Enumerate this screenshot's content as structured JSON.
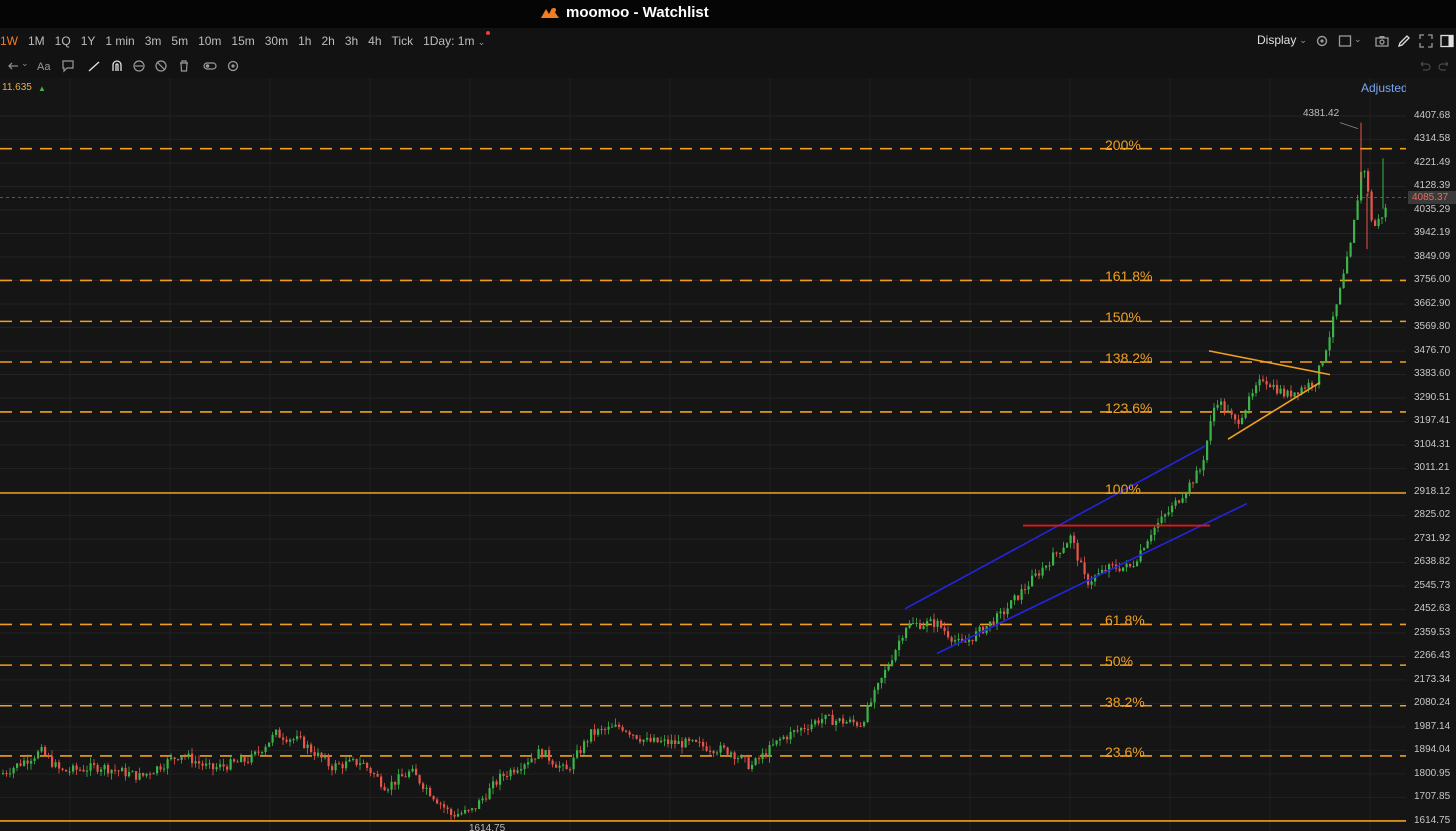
{
  "window": {
    "title": "moomoo - Watchlist"
  },
  "timeframes": [
    {
      "label": "1W",
      "active": true
    },
    {
      "label": "1M"
    },
    {
      "label": "1Q"
    },
    {
      "label": "1Y"
    },
    {
      "label": "1 min"
    },
    {
      "label": "3m"
    },
    {
      "label": "5m"
    },
    {
      "label": "10m"
    },
    {
      "label": "15m"
    },
    {
      "label": "30m"
    },
    {
      "label": "1h"
    },
    {
      "label": "2h"
    },
    {
      "label": "3h"
    },
    {
      "label": "4h"
    },
    {
      "label": "Tick"
    },
    {
      "label": "1Day: 1m"
    }
  ],
  "display_label": "Display",
  "indicator_value": "11.635",
  "adjusted_label": "Adjusted",
  "price_axis": [
    "4407.68",
    "4314.58",
    "4221.49",
    "4128.39",
    "4035.29",
    "3942.19",
    "3849.09",
    "3756.00",
    "3662.90",
    "3569.80",
    "3476.70",
    "3383.60",
    "3290.51",
    "3197.41",
    "3104.31",
    "3011.21",
    "2918.12",
    "2825.02",
    "2731.92",
    "2638.82",
    "2545.73",
    "2452.63",
    "2359.53",
    "2266.43",
    "2173.34",
    "2080.24",
    "1987.14",
    "1894.04",
    "1800.95",
    "1707.85"
  ],
  "current_price": "4085.37",
  "low_axis_price": "1614.75",
  "high_marker": "4381.42",
  "low_marker": "1614.75",
  "fib_levels": [
    {
      "label": "200%",
      "price": 4278
    },
    {
      "label": "161.8%",
      "price": 3756
    },
    {
      "label": "150%",
      "price": 3594
    },
    {
      "label": "138.2%",
      "price": 3433
    },
    {
      "label": "123.6%",
      "price": 3235
    },
    {
      "label": "100%",
      "price": 2914,
      "solid": true
    },
    {
      "label": "61.8%",
      "price": 2393
    },
    {
      "label": "50%",
      "price": 2232
    },
    {
      "label": "38.2%",
      "price": 2071
    },
    {
      "label": "23.6%",
      "price": 1872
    },
    {
      "label": "",
      "price": 1614.75,
      "solid": true
    }
  ],
  "colors": {
    "up": "#3cb44a",
    "down": "#e8554a",
    "fib": "#f0a020",
    "channel": "#2424e0",
    "resistance": "#e01818",
    "accent": "#f47c20",
    "link": "#7aa6f5"
  }
}
